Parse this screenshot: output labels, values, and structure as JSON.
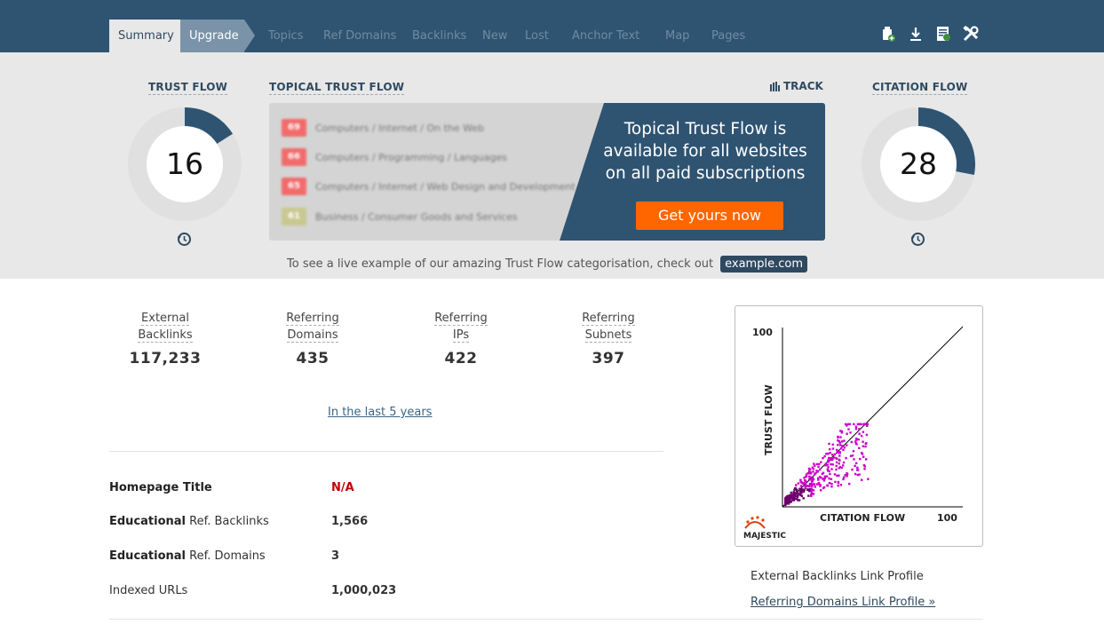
{
  "nav": {
    "tabs": [
      {
        "label": "Summary",
        "active": true
      },
      {
        "label": "Upgrade"
      },
      {
        "label": "Topics"
      },
      {
        "label": "Ref Domains"
      },
      {
        "label": "Backlinks"
      },
      {
        "label": "New"
      },
      {
        "label": "Lost"
      },
      {
        "label": "Anchor Text"
      },
      {
        "label": "Map"
      },
      {
        "label": "Pages"
      }
    ],
    "icons": [
      "add-to-bucket-icon",
      "download-icon",
      "report-icon",
      "tools-icon"
    ]
  },
  "trust_flow": {
    "label": "TRUST FLOW",
    "value": "16",
    "fraction": 0.16,
    "color": "#2f5472"
  },
  "citation_flow": {
    "label": "CITATION FLOW",
    "value": "28",
    "fraction": 0.28,
    "color": "#2f5472"
  },
  "topical_trust_flow": {
    "label": "TOPICAL TRUST FLOW",
    "track_label": "TRACK",
    "rows": [
      {
        "score": "69",
        "topic": "Computers / Internet / On the Web",
        "color": "#f26b6b"
      },
      {
        "score": "66",
        "topic": "Computers / Programming / Languages",
        "color": "#f26b6b"
      },
      {
        "score": "65",
        "topic": "Computers / Internet / Web Design and Development",
        "color": "#f26b6b"
      },
      {
        "score": "61",
        "topic": "Business / Consumer Goods and Services",
        "color": "#c8c890"
      }
    ],
    "promo_text": "Topical Trust Flow is available for all websites on all paid subscriptions",
    "cta_label": "Get yours now",
    "promo_color": "#2f5472"
  },
  "example": {
    "text": "To see a live example of our amazing Trust Flow categorisation, check out",
    "link": "example.com"
  },
  "stats": [
    {
      "label_1": "External",
      "label_2": "Backlinks",
      "value": "117,233"
    },
    {
      "label_1": "Referring",
      "label_2": "Domains",
      "value": "435"
    },
    {
      "label_1": "Referring",
      "label_2": "IPs",
      "value": "422"
    },
    {
      "label_1": "Referring",
      "label_2": "Subnets",
      "value": "397"
    }
  ],
  "period_link": "In the last 5 years",
  "info": [
    {
      "label_bold": "Homepage Title",
      "label_rest": "",
      "value": "N/A",
      "na": true
    },
    {
      "label_bold": "Educational",
      "label_rest": " Ref. Backlinks",
      "value": "1,566"
    },
    {
      "label_bold": "Educational",
      "label_rest": " Ref. Domains",
      "value": "3"
    },
    {
      "label_bold": "",
      "label_rest": "Indexed URLs",
      "value": "1,000,023"
    }
  ],
  "scatter": {
    "y_axis_label": "TRUST FLOW",
    "x_axis_label": "CITATION FLOW",
    "y_max_label": "100",
    "x_max_label": "100",
    "brand": "MAJESTIC",
    "point_color": "#cc00cc"
  },
  "side_links": {
    "external_profile": "External Backlinks Link Profile",
    "referring_profile": "Referring Domains Link Profile »"
  }
}
